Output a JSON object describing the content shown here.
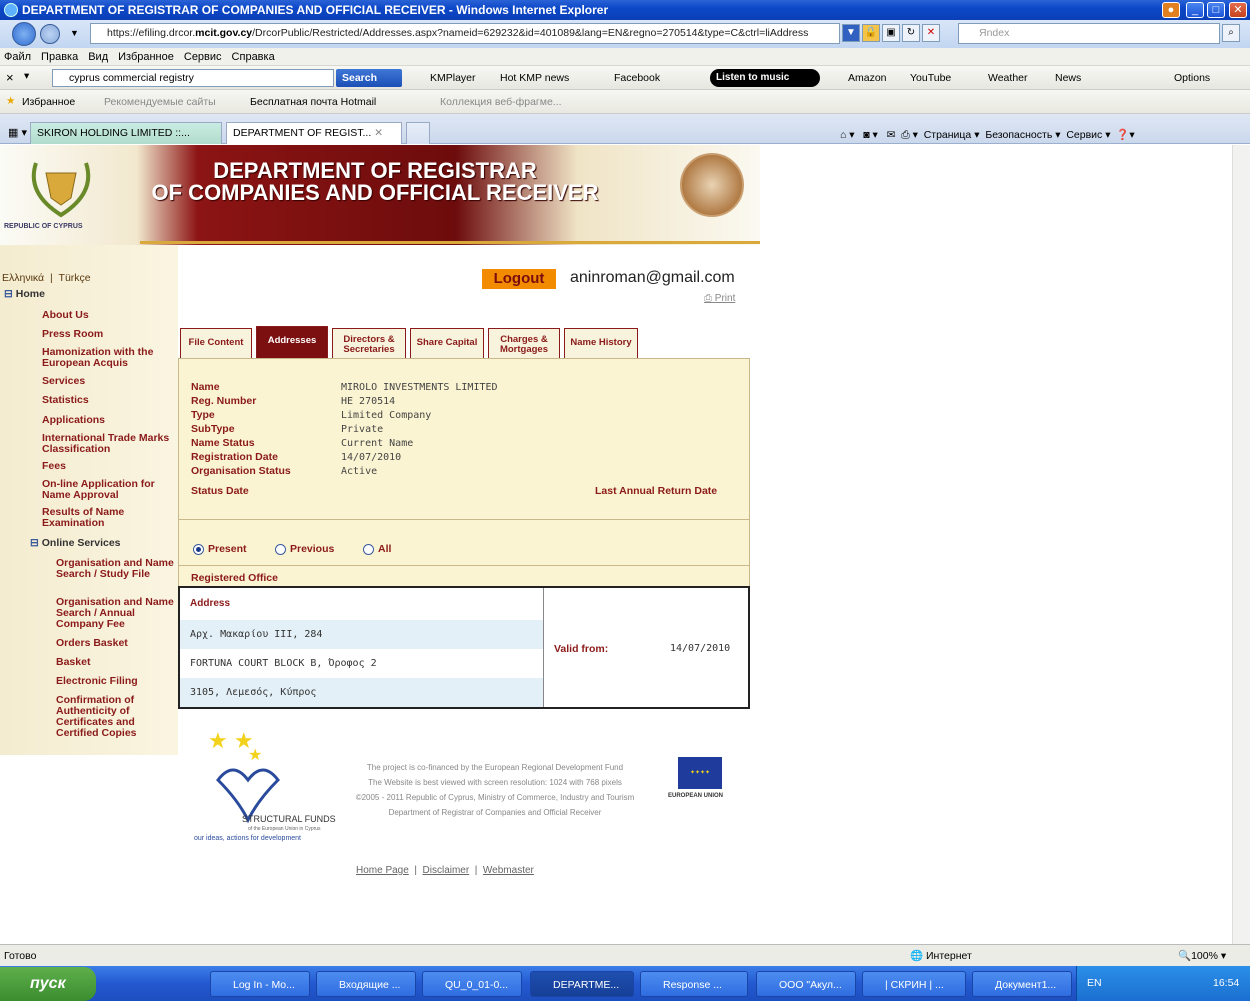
{
  "window": {
    "title": "DEPARTMENT OF REGISTRAR OF COMPANIES AND OFFICIAL RECEIVER - Windows Internet Explorer"
  },
  "address_bar": {
    "url_prefix": "https://efiling.drcor.",
    "url_domain": "mcit.gov.cy",
    "url_rest": "/DrcorPublic/Restricted/Addresses.aspx?nameid=629232&id=401089&lang=EN&regno=270514&type=C&ctrl=liAddress",
    "yandex_placeholder": "Яndex"
  },
  "menu": [
    "Файл",
    "Правка",
    "Вид",
    "Избранное",
    "Сервис",
    "Справка"
  ],
  "ask_toolbar": {
    "search_value": "cyprus commercial registry",
    "search_button": "Search",
    "kmplayer": "KMPlayer",
    "hotkmp": "Hot KMP news",
    "facebook": "Facebook",
    "listen": "Listen to music",
    "amazon": "Amazon",
    "youtube": "YouTube",
    "weather": "Weather",
    "news": "News",
    "options": "Options"
  },
  "favorites": {
    "label": "Избранное",
    "recommended": "Рекомендуемые сайты",
    "hotmail": "Бесплатная почта Hotmail",
    "collection": "Коллекция веб-фрагме..."
  },
  "tabs": [
    {
      "label": "SKIRON HOLDING LIMITED ::..."
    },
    {
      "label": "DEPARTMENT OF REGIST..."
    }
  ],
  "command_bar": {
    "page": "Страница",
    "safety": "Безопасность",
    "service": "Сервис"
  },
  "site": {
    "header_line1": "DEPARTMENT OF REGISTRAR",
    "header_line2": "OF COMPANIES AND OFFICIAL RECEIVER",
    "republic": "REPUBLIC OF CYPRUS",
    "lang_greek": "Ελληνικά",
    "lang_turkish": "Türkçe",
    "logout": "Logout",
    "email": "aninroman@gmail.com",
    "print": "Print"
  },
  "nav": {
    "home": "Home",
    "items": [
      "About Us",
      "Press Room",
      "Hamonization with the European Acquis",
      "Services",
      "Statistics",
      "Applications",
      "International Trade Marks Classification",
      "Fees",
      "On-line Application for Name Approval",
      "Results of Name Examination"
    ],
    "online": "Online Services",
    "sub": [
      "Organisation and Name Search / Study File",
      "Organisation and Name Search / Annual Company Fee",
      "Orders Basket",
      "Basket",
      "Electronic Filing",
      "Confirmation of Authenticity of Certificates and Certified Copies"
    ]
  },
  "page_tabs": [
    "File Content",
    "Addresses",
    "Directors & Secretaries",
    "Share Capital",
    "Charges & Mortgages",
    "Name History"
  ],
  "company": {
    "name_l": "Name",
    "name": "MIROLO INVESTMENTS LIMITED",
    "reg_l": "Reg. Number",
    "reg": "HE 270514",
    "type_l": "Type",
    "type": "Limited Company",
    "subtype_l": "SubType",
    "subtype": "Private",
    "status_l": "Name Status",
    "status": "Current Name",
    "regdate_l": "Registration Date",
    "regdate": "14/07/2010",
    "orgstatus_l": "Organisation Status",
    "orgstatus": "Active",
    "statusdate_l": "Status Date",
    "lastreturn_l": "Last Annual Return Date"
  },
  "filter": {
    "present": "Present",
    "previous": "Previous",
    "all": "All"
  },
  "registered_office": {
    "heading": "Registered Office",
    "address_l": "Address",
    "lines": [
      "Αρχ. Μακαρίου ΙΙΙ, 284",
      "FORTUNA COURT BLOCK B, Όροφος 2",
      "3105, Λεμεσός, Κύπρος"
    ],
    "valid_l": "Valid from:",
    "valid": "14/07/2010"
  },
  "footer": {
    "lines": [
      "The project is co-financed by the European Regional Development Fund",
      "The Website is best viewed with screen resolution: 1024 with 768 pixels",
      "©2005 - 2011 Republic of Cyprus, Ministry of Commerce, Industry and Tourism",
      "Department of Registrar of Companies and Official Receiver"
    ],
    "structural": "STRUCTURAL FUNDS",
    "structural_sub": "of the European Union in Cyprus",
    "slogan": "our ideas, actions for development",
    "eu": "EUROPEAN UNION",
    "home": "Home Page",
    "disclaimer": "Disclaimer",
    "webmaster": "Webmaster"
  },
  "status": {
    "ready": "Готово",
    "zone": "Интернет",
    "zoom": "100%"
  },
  "taskbar": {
    "start": "пуск",
    "tasks": [
      "Log In - Mo...",
      "Входящие ...",
      "QU_0_01-0...",
      "DEPARTME...",
      "Response ...",
      "ООО \"Акул...",
      "| СКРИН | ...",
      "Документ1..."
    ],
    "lang": "EN",
    "time": "16:54"
  }
}
